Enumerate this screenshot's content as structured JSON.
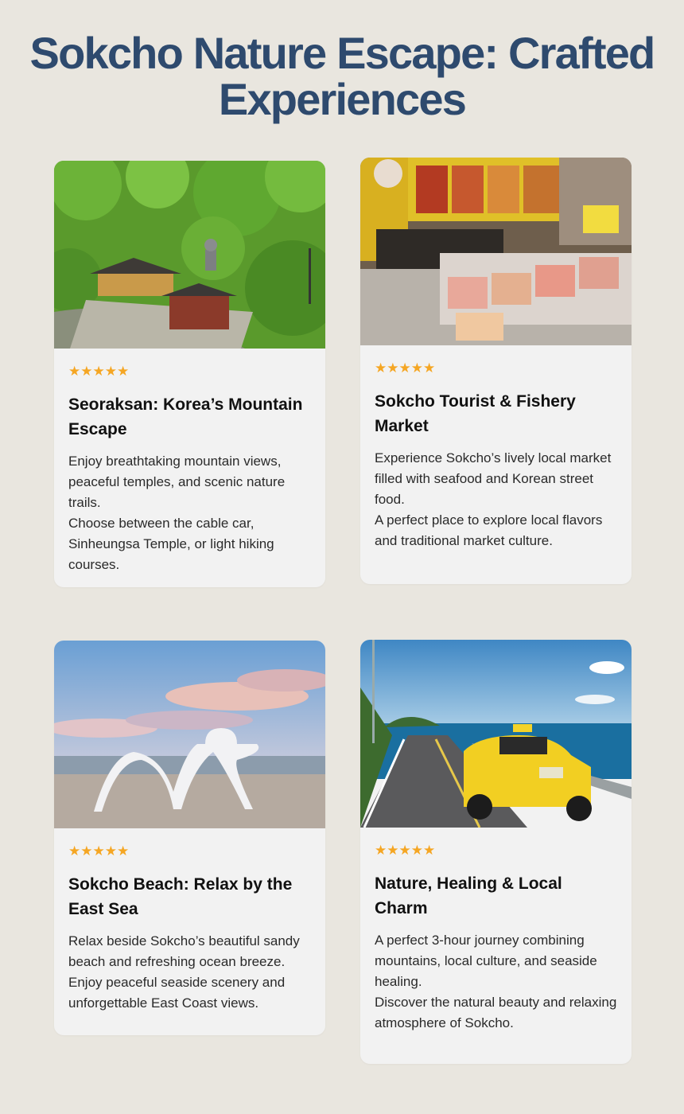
{
  "page": {
    "title": "Sokcho Nature Escape: Crafted Experiences"
  },
  "colors": {
    "background": "#e9e6df",
    "title": "#2e4a6e",
    "card": "#f2f2f2",
    "star": "#f5a623"
  },
  "cards": [
    {
      "stars": "★★★★★",
      "title": "Seoraksan: Korea’s Mountain Escape",
      "description": [
        "Enjoy breathtaking mountain views, peaceful temples, and scenic nature trails.",
        "Choose between the cable car, Sinheungsa Temple, or light hiking courses."
      ]
    },
    {
      "stars": "★★★★★",
      "title": "Sokcho Tourist & Fishery Market",
      "description": [
        "Experience Sokcho’s lively local market filled with seafood and Korean street food.",
        "A perfect place to explore local flavors and traditional market culture."
      ]
    },
    {
      "stars": "★★★★★",
      "title": "Sokcho Beach: Relax by the East Sea",
      "description": [
        "Relax beside Sokcho’s beautiful sandy beach and refreshing ocean breeze.",
        "Enjoy peaceful seaside scenery and unforgettable East Coast views."
      ]
    },
    {
      "stars": "★★★★★",
      "title": "Nature, Healing & Local Charm",
      "description": [
        "A perfect 3-hour journey combining mountains, local culture, and seaside healing.",
        "Discover the natural beauty and relaxing atmosphere of Sokcho."
      ]
    }
  ]
}
